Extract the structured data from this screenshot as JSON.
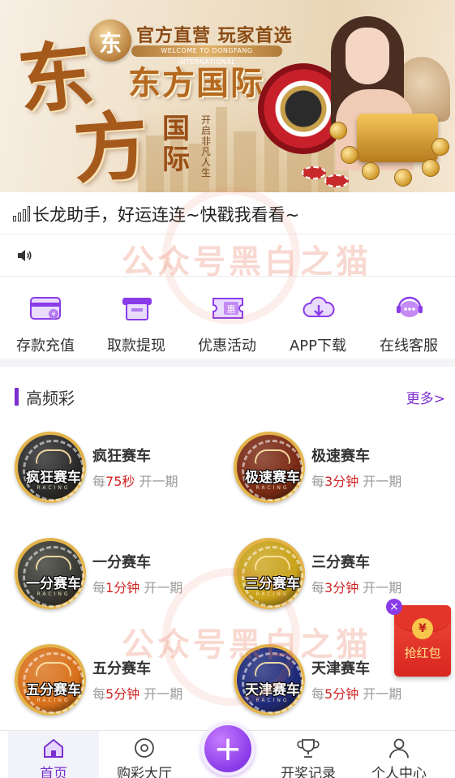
{
  "banner": {
    "slogan": "官方直营 玩家首选",
    "english_ribbon": "WELCOME TO DONGFANG INTERNATIONAL",
    "brand_name": "东方国际",
    "big_char_1": "东",
    "big_char_2": "方",
    "guoji": "国际",
    "tagline_vertical": "开启非凡人生"
  },
  "notice": {
    "text": "长龙助手，好运连连~快戳我看看~"
  },
  "quick_actions": [
    {
      "label": "存款充值",
      "icon": "deposit-card-icon"
    },
    {
      "label": "取款提现",
      "icon": "withdraw-atm-icon"
    },
    {
      "label": "优惠活动",
      "icon": "promo-ticket-icon"
    },
    {
      "label": "APP下载",
      "icon": "cloud-download-icon"
    },
    {
      "label": "在线客服",
      "icon": "chat-support-icon"
    }
  ],
  "section": {
    "title": "高频彩",
    "more": "更多>"
  },
  "lotteries": [
    {
      "name": "疯狂赛车",
      "badge": "疯狂赛车",
      "racing": "RACING",
      "prefix": "每",
      "interval": "75秒",
      "suffix": "开一期",
      "color": "#2a2a2a"
    },
    {
      "name": "极速赛车",
      "badge": "极速赛车",
      "racing": "RACING",
      "prefix": "每",
      "interval": "3分钟",
      "suffix": "开一期",
      "color": "#7a2a14"
    },
    {
      "name": "一分赛车",
      "badge": "一分赛车",
      "racing": "RACING",
      "prefix": "每",
      "interval": "1分钟",
      "suffix": "开一期",
      "color": "#3a3a34"
    },
    {
      "name": "三分赛车",
      "badge": "三分赛车",
      "racing": "RACING",
      "prefix": "每",
      "interval": "3分钟",
      "suffix": "开一期",
      "color": "#c9a21a"
    },
    {
      "name": "五分赛车",
      "badge": "五分赛车",
      "racing": "RACING",
      "prefix": "每",
      "interval": "5分钟",
      "suffix": "开一期",
      "color": "#d8701a"
    },
    {
      "name": "天津赛车",
      "badge": "天津赛车",
      "racing": "RACING",
      "prefix": "每",
      "interval": "5分钟",
      "suffix": "开一期",
      "color": "#1e2a7a"
    }
  ],
  "red_packet": {
    "label": "抢红包",
    "coin": "¥",
    "close": "×"
  },
  "watermark": "公众号黑白之猫",
  "tabbar": {
    "items": [
      {
        "label": "首页",
        "icon": "home-icon",
        "active": true
      },
      {
        "label": "购彩大厅",
        "icon": "lottery-hall-icon",
        "active": false
      },
      {
        "label": "开奖记录",
        "icon": "trophy-icon",
        "active": false
      },
      {
        "label": "个人中心",
        "icon": "user-icon",
        "active": false
      }
    ],
    "center": "+"
  },
  "colors": {
    "accent": "#7b2fd0",
    "highlight": "#d02424"
  }
}
